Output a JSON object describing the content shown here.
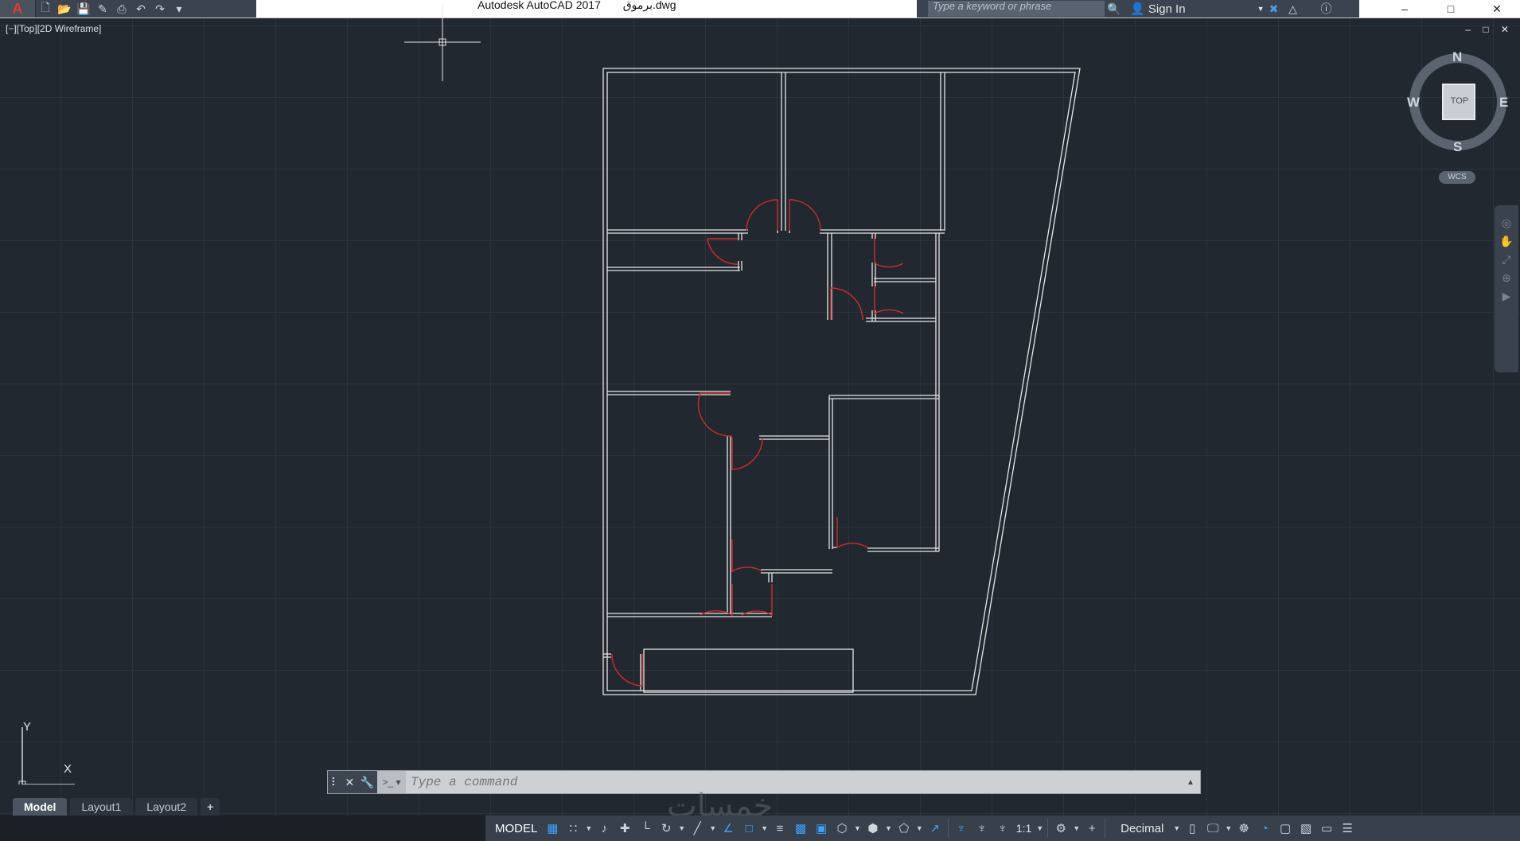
{
  "title_bar": {
    "app_title": "Autodesk AutoCAD 2017",
    "file_name": "برموق.dwg",
    "search_placeholder": "Type a keyword or phrase",
    "sign_in": "Sign In"
  },
  "viewport": {
    "label": "[−][Top][2D Wireframe]",
    "controls": "– □ ✕"
  },
  "viewcube": {
    "north": "N",
    "south": "S",
    "east": "E",
    "west": "W",
    "face": "TOP",
    "ucs_menu": "WCS"
  },
  "ucs_icon": {
    "y_label": "Y",
    "x_label": "X"
  },
  "command_line": {
    "placeholder": "Type a command"
  },
  "layout_tabs": [
    {
      "label": "Model",
      "active": true
    },
    {
      "label": "Layout1",
      "active": false
    },
    {
      "label": "Layout2",
      "active": false
    },
    {
      "label": "+",
      "active": false
    }
  ],
  "watermark": "خمسات",
  "status_bar": {
    "model_label": "MODEL",
    "annotation_scale": "1:1",
    "units": "Decimal"
  },
  "colors": {
    "background": "#212830",
    "grid": "#2b333d",
    "wall_lines": "#e8e8e8",
    "door_arcs": "#d22b2b",
    "accent_blue": "#3ea0ff"
  }
}
